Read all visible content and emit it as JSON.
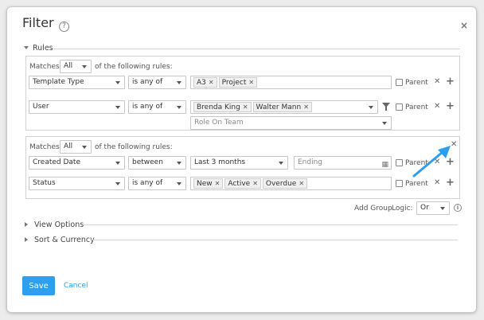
{
  "dialog": {
    "title": "Filter",
    "help_icon": "question-circle-icon",
    "close_icon": "close-icon"
  },
  "sections": {
    "rules": "Rules",
    "view_options": "View Options",
    "sort_currency": "Sort & Currency"
  },
  "groups": [
    {
      "matches_label": "Matches",
      "match_value": "All",
      "of_rules_label": "of the following rules:",
      "rows": [
        {
          "field": "Template Type",
          "operator": "is any of",
          "chips": [
            "A3",
            "Project"
          ],
          "parent_label": "Parent"
        },
        {
          "field": "User",
          "operator": "is any of",
          "chips": [
            "Brenda King",
            "Walter Mann"
          ],
          "parent_label": "Parent",
          "sub_select": "Role On Team"
        }
      ]
    },
    {
      "matches_label": "Matches",
      "match_value": "All",
      "of_rules_label": "of the following rules:",
      "rows": [
        {
          "field": "Created Date",
          "operator": "between",
          "value": "Last 3 months",
          "end_placeholder": "Ending",
          "parent_label": "Parent"
        },
        {
          "field": "Status",
          "operator": "is any of",
          "chips": [
            "New",
            "Active",
            "Overdue"
          ],
          "parent_label": "Parent"
        }
      ]
    }
  ],
  "footer_controls": {
    "add_group": "Add Group",
    "logic_label": "Logic:",
    "logic_value": "Or"
  },
  "buttons": {
    "save": "Save",
    "cancel": "Cancel"
  },
  "annotation": {
    "arrow_color": "#2e9fef"
  }
}
